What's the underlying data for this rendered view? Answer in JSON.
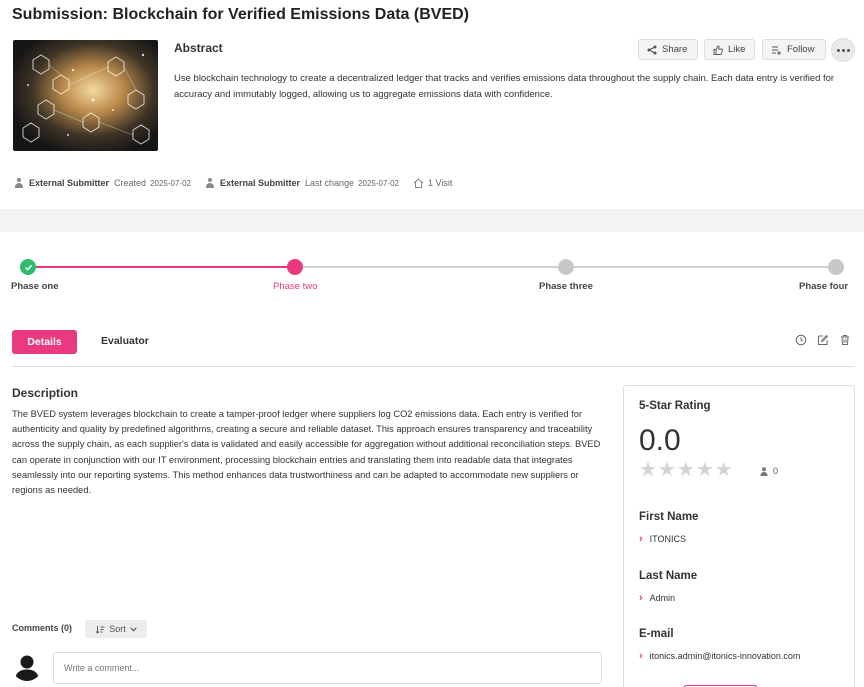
{
  "header": {
    "title": "Submission: Blockchain for Verified Emissions Data (BVED)"
  },
  "abstract": {
    "heading": "Abstract",
    "text": "Use blockchain technology to create a decentralized ledger that tracks and verifies emissions data throughout the supply chain. Each data entry is verified for accuracy and immutably logged, allowing us to aggregate emissions data with confidence."
  },
  "actions": {
    "share": "Share",
    "like": "Like",
    "follow": "Follow"
  },
  "meta": {
    "creator": "External Submitter",
    "created_label": "Created",
    "created_date": "2025-07-02",
    "modifier": "External Submitter",
    "changed_label": "Last change",
    "changed_date": "2025-07-02",
    "visits": "1 Visit"
  },
  "phases": [
    {
      "label": "Phase one",
      "status": "done"
    },
    {
      "label": "Phase two",
      "status": "current"
    },
    {
      "label": "Phase three",
      "status": "upcoming"
    },
    {
      "label": "Phase four",
      "status": "upcoming"
    }
  ],
  "tabs": {
    "details": "Details",
    "evaluator": "Evaluator"
  },
  "description": {
    "heading": "Description",
    "text": "The BVED system leverages blockchain to create a tamper-proof ledger where suppliers log CO2 emissions data. Each entry is verified for authenticity and quality by predefined algorithms, creating a secure and reliable dataset. This approach ensures transparency and traceability across the supply chain, as each supplier's data is validated and easily accessible for aggregation without additional reconciliation steps. BVED can operate in conjunction with our IT environment, processing blockchain entries and translating them into readable data that integrates seamlessly into our reporting systems. This method enhances data trustworthiness and can be adapted to accommodate new suppliers or regions as needed."
  },
  "comments": {
    "label": "Comments (0)",
    "sort": "Sort",
    "placeholder": "Write a comment..."
  },
  "rating": {
    "heading": "5-Star Rating",
    "value": "0.0",
    "stars_filled": 0,
    "stars_total": 5,
    "count": "0"
  },
  "fields": [
    {
      "label": "First Name",
      "value": "ITONICS"
    },
    {
      "label": "Last Name",
      "value": "Admin"
    },
    {
      "label": "E-mail",
      "value": "itonics.admin@itonics-innovation.com"
    }
  ],
  "colors": {
    "accent": "#ea3a7f",
    "done": "#2ebd6b",
    "upcoming": "#c8c8c8"
  }
}
